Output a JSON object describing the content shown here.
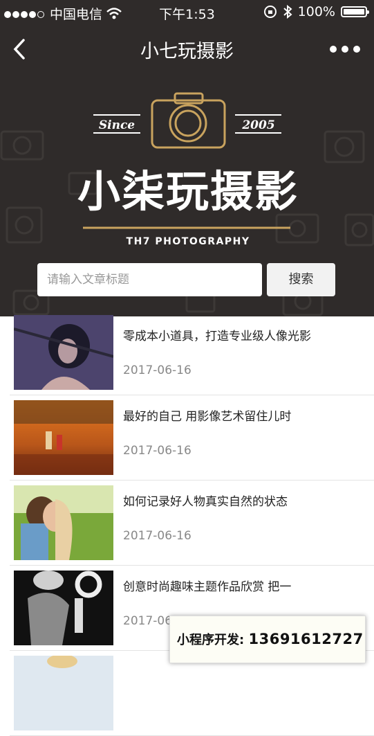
{
  "status_bar": {
    "carrier": "中国电信",
    "time": "下午1:53",
    "battery": "100%"
  },
  "nav": {
    "title": "小七玩摄影"
  },
  "banner": {
    "since": "Since",
    "year": "2005",
    "brand": "小柒玩摄影",
    "subtitle": "TH7 PHOTOGRAPHY"
  },
  "search": {
    "placeholder": "请输入文章标题",
    "button": "搜索"
  },
  "articles": [
    {
      "title": "零成本小道具，打造专业级人像光影",
      "date": "2017-06-16"
    },
    {
      "title": "最好的自己 用影像艺术留住儿时",
      "date": "2017-06-16"
    },
    {
      "title": "如何记录好人物真实自然的状态",
      "date": "2017-06-16"
    },
    {
      "title": "创意时尚趣味主题作品欣赏 把一",
      "date": "2017-06-16"
    }
  ],
  "floating_banner": {
    "label": "小程序开发:",
    "phone": "13691612727"
  }
}
